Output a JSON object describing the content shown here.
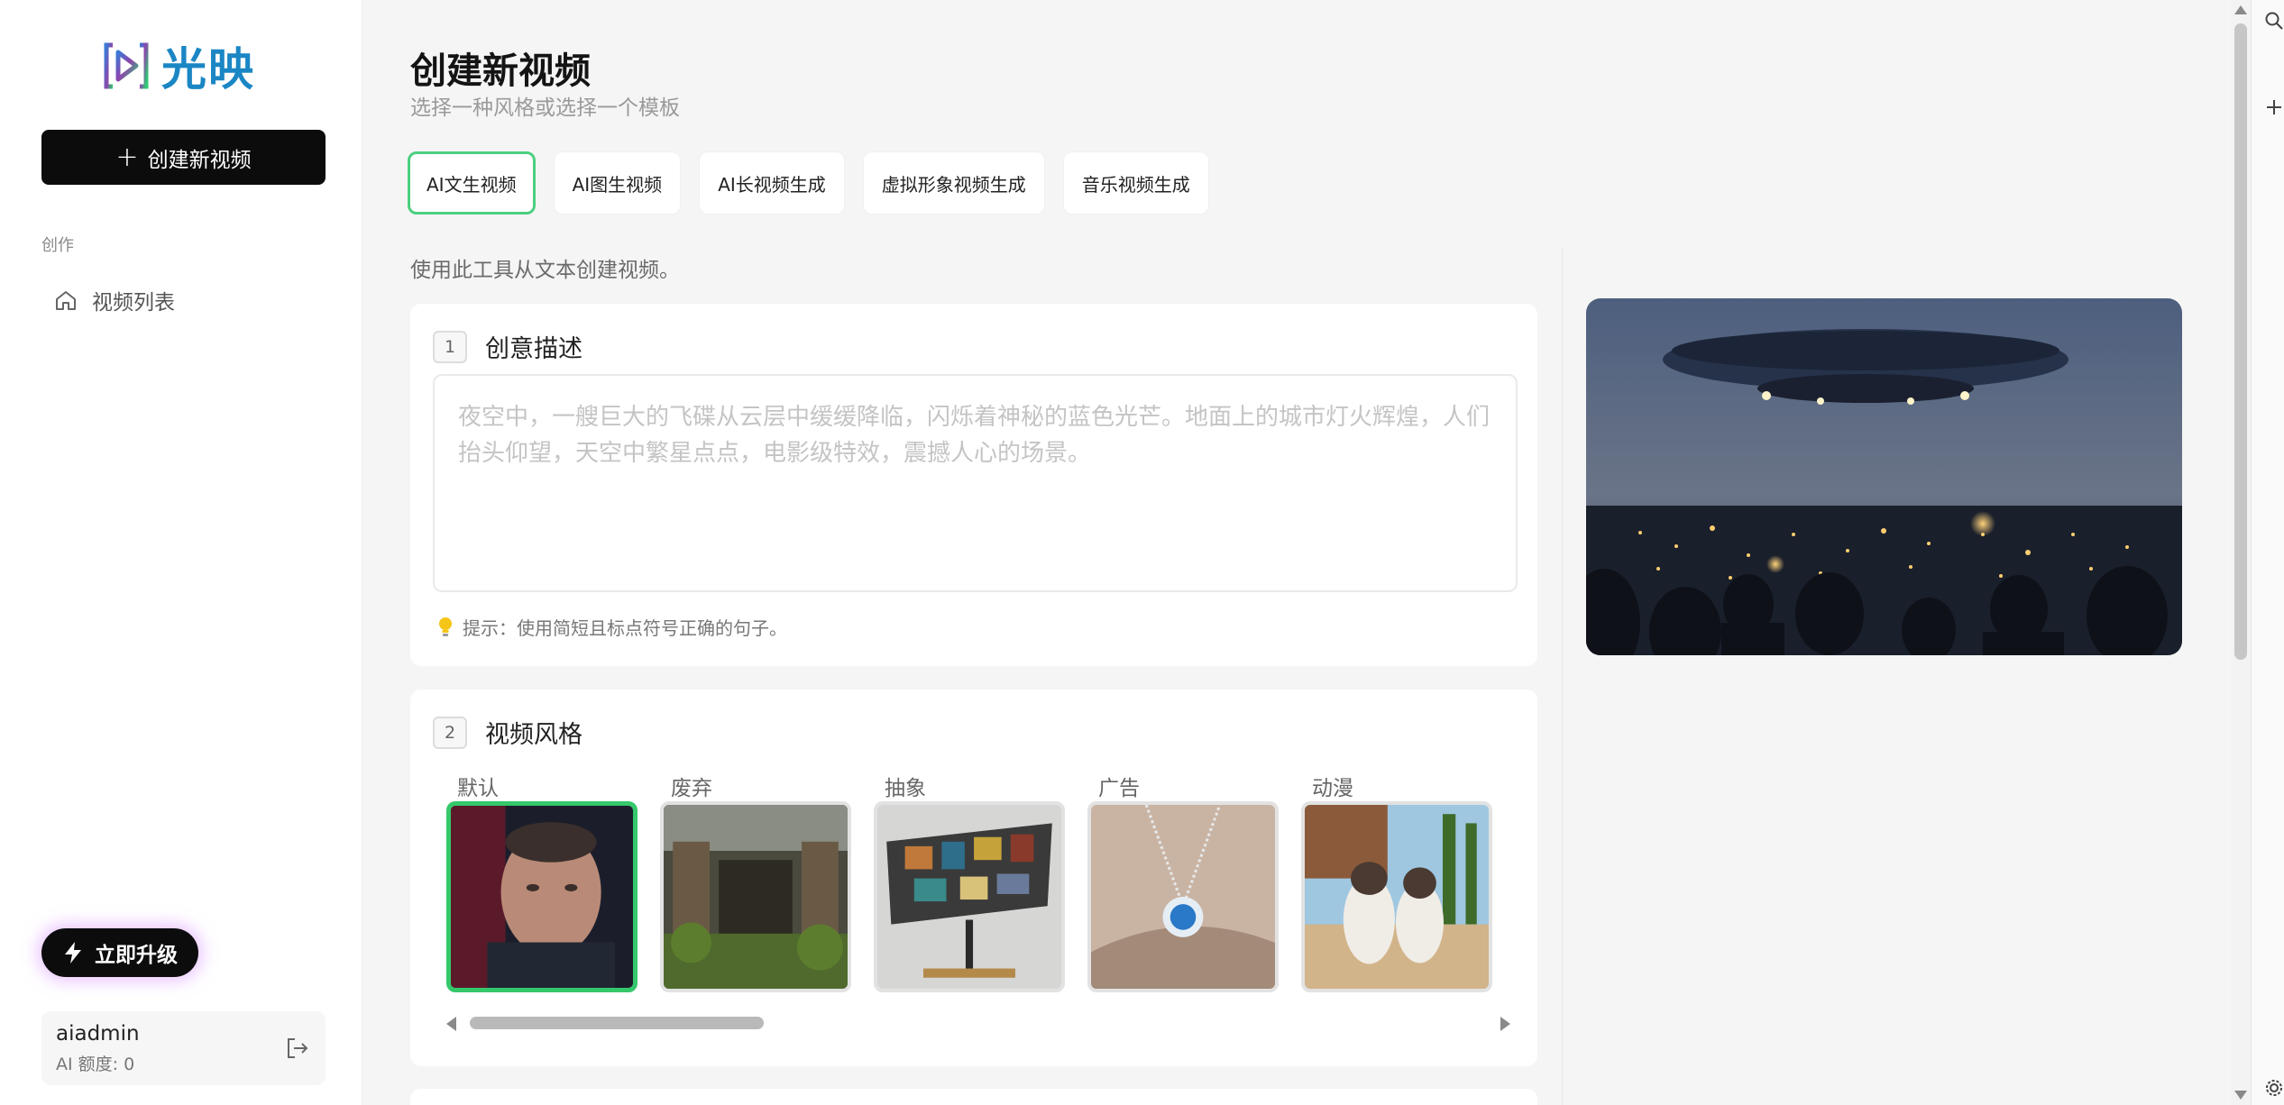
{
  "brand": {
    "name": "光映",
    "colors": {
      "accent": "#34c86b",
      "dark": "#0c0c0c",
      "logo": "#1b86c4"
    }
  },
  "sidebar": {
    "create_button": "创建新视频",
    "section_label": "创作",
    "items": [
      {
        "label": "视频列表",
        "icon": "home-icon"
      }
    ],
    "upgrade_button": "立即升级",
    "user": {
      "name": "aiadmin",
      "quota": "AI 额度: 0"
    }
  },
  "main": {
    "title": "创建新视频",
    "subtitle": "选择一种风格或选择一个模板",
    "tabs": [
      {
        "label": "AI文生视频",
        "active": true
      },
      {
        "label": "AI图生视频",
        "active": false
      },
      {
        "label": "AI长视频生成",
        "active": false
      },
      {
        "label": "虚拟形象视频生成",
        "active": false
      },
      {
        "label": "音乐视频生成",
        "active": false
      }
    ],
    "tool_description": "使用此工具从文本创建视频。",
    "step1": {
      "number": "1",
      "title": "创意描述",
      "placeholder": "夜空中，一艘巨大的飞碟从云层中缓缓降临，闪烁着神秘的蓝色光芒。地面上的城市灯火辉煌，人们抬头仰望，天空中繁星点点，电影级特效，震撼人心的场景。",
      "value": "",
      "hint": "提示：使用简短且标点符号正确的句子。"
    },
    "step2": {
      "number": "2",
      "title": "视频风格",
      "styles": [
        {
          "label": "默认",
          "selected": true
        },
        {
          "label": "废弃",
          "selected": false
        },
        {
          "label": "抽象",
          "selected": false
        },
        {
          "label": "广告",
          "selected": false
        },
        {
          "label": "动漫",
          "selected": false
        }
      ]
    }
  }
}
